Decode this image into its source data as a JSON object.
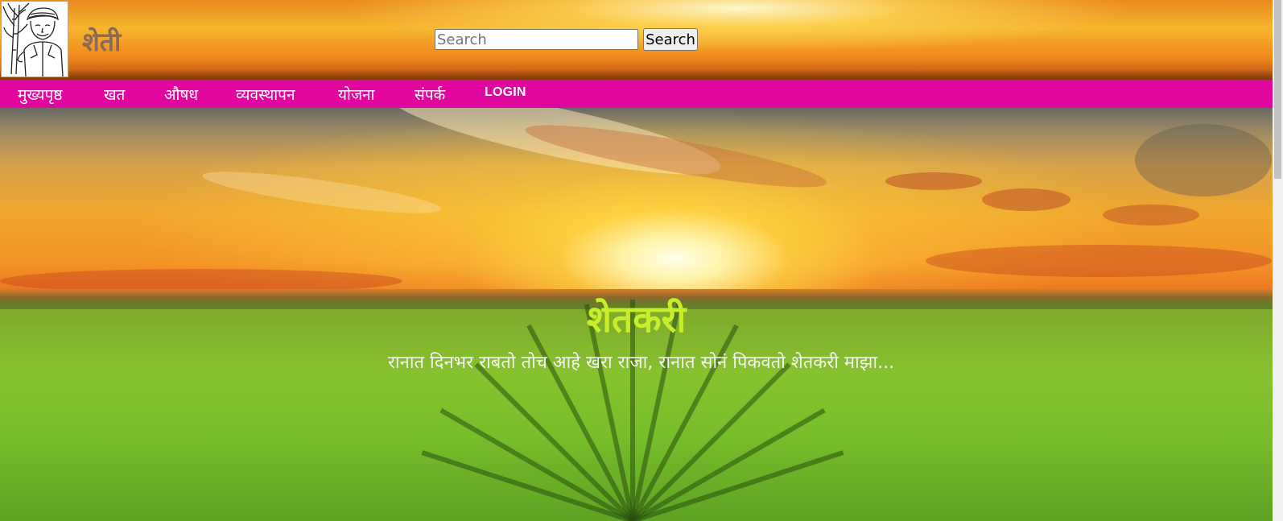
{
  "header": {
    "site_title": "शेती",
    "search": {
      "placeholder": "Search",
      "value": "",
      "button_label": "Search"
    }
  },
  "nav": {
    "items": [
      {
        "label": "मुख्यपृष्ठ"
      },
      {
        "label": "खत"
      },
      {
        "label": "औषध"
      },
      {
        "label": "व्यवस्थापन"
      },
      {
        "label": "योजना"
      },
      {
        "label": "संपर्क"
      },
      {
        "label": "LOGIN"
      }
    ]
  },
  "hero": {
    "title": "शेतकरी",
    "subtitle": "रानात दिनभर राबतो तोच आहे खरा राजा, रानात सोनं पिकवतो शेतकरी माझा..."
  },
  "colors": {
    "nav_background": "#e0069e",
    "hero_title": "#c6ef2a",
    "site_title": "#8a6a55"
  },
  "icons": {
    "logo": "farmer-with-sugarcane-logo"
  }
}
